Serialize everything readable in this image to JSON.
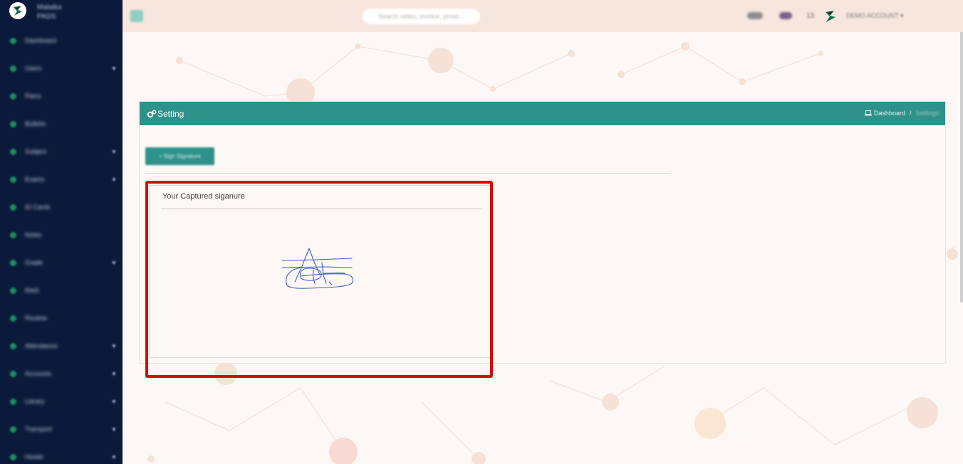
{
  "app": {
    "brand_name": "Malaika",
    "brand_sub": "PADS"
  },
  "sidebar": {
    "items": [
      {
        "label": "Dashboard",
        "icon": "home-icon",
        "has_caret": false
      },
      {
        "label": "Users",
        "icon": "users-icon",
        "has_caret": true
      },
      {
        "label": "Plans",
        "icon": "plans-icon",
        "has_caret": false
      },
      {
        "label": "Bulletin",
        "icon": "bulletin-icon",
        "has_caret": false
      },
      {
        "label": "Subject",
        "icon": "subject-icon",
        "has_caret": true
      },
      {
        "label": "Exams",
        "icon": "exams-icon",
        "has_caret": true
      },
      {
        "label": "ID Cards",
        "icon": "card-icon",
        "has_caret": false
      },
      {
        "label": "Notes",
        "icon": "notes-icon",
        "has_caret": false
      },
      {
        "label": "Grade",
        "icon": "grade-icon",
        "has_caret": true
      },
      {
        "label": "Mark",
        "icon": "mark-icon",
        "has_caret": false
      },
      {
        "label": "Routine",
        "icon": "routine-icon",
        "has_caret": false
      },
      {
        "label": "Attendance",
        "icon": "attendance-icon",
        "has_caret": true
      },
      {
        "label": "Accounts",
        "icon": "accounts-icon",
        "has_caret": true
      },
      {
        "label": "Library",
        "icon": "library-icon",
        "has_caret": true
      },
      {
        "label": "Transport",
        "icon": "transport-icon",
        "has_caret": true
      },
      {
        "label": "Hostel",
        "icon": "hostel-icon",
        "has_caret": true
      }
    ]
  },
  "topbar": {
    "search_placeholder": "Search notes, invoice, photo...",
    "notif_count": "13",
    "account_name": "DEMO ACCOUNT"
  },
  "page": {
    "title": "Setting",
    "breadcrumb_home": "Dashboard",
    "breadcrumb_sep": "/",
    "breadcrumb_current": "Settings",
    "history_button": "+ Sign Signature",
    "card_title": "Your Captured siganure"
  },
  "colors": {
    "sidebar": "#0b1a3a",
    "accent": "#2e918a",
    "topbar": "#f6e6dd",
    "highlight": "#d70a0a"
  }
}
